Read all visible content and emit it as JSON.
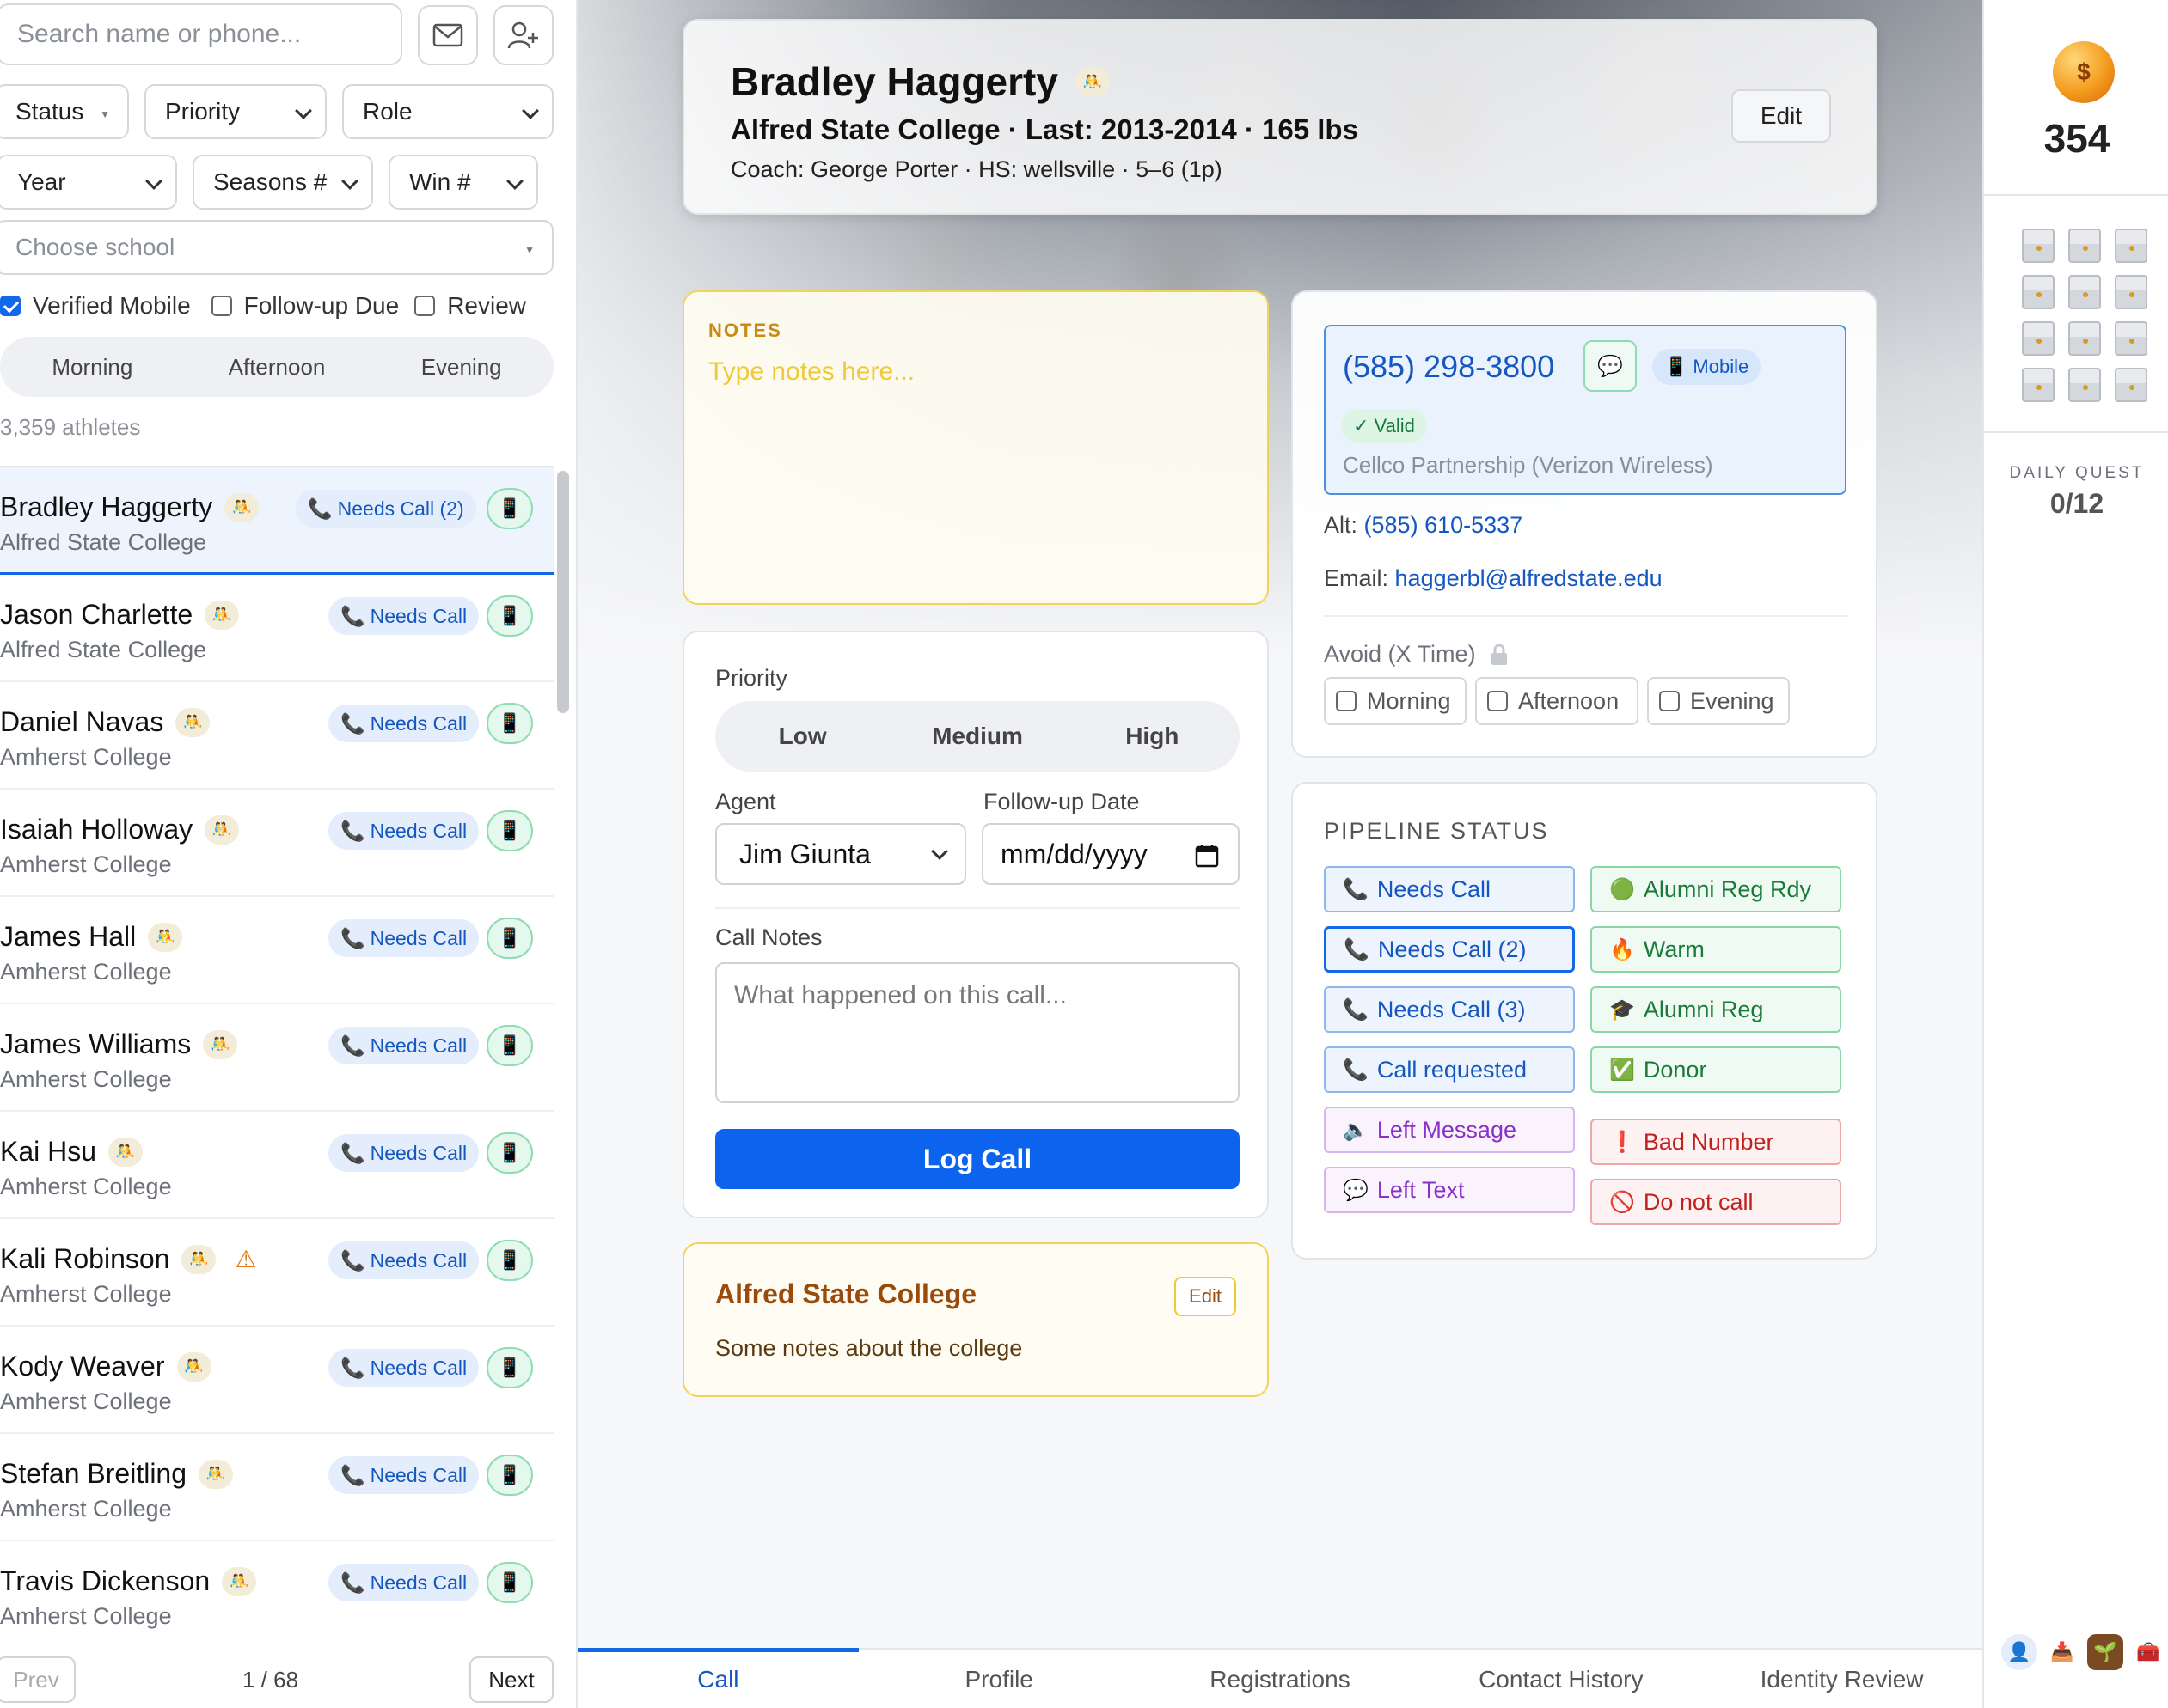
{
  "sidebar": {
    "search_placeholder": "Search name or phone...",
    "filters": {
      "status": "Status",
      "priority": "Priority",
      "role": "Role",
      "year": "Year",
      "seasons": "Seasons #",
      "win": "Win #",
      "school_placeholder": "Choose school"
    },
    "checkboxes": [
      {
        "label": "Verified Mobile",
        "checked": true
      },
      {
        "label": "Follow-up Due",
        "checked": false
      },
      {
        "label": "Review",
        "checked": false
      }
    ],
    "time_segments": [
      "Morning",
      "Afternoon",
      "Evening"
    ],
    "count": "3,359 athletes",
    "athletes": [
      {
        "name": "Bradley Haggerty",
        "school": "Alfred State College",
        "status": "Needs Call (2)",
        "active": true,
        "warning": false
      },
      {
        "name": "Jason Charlette",
        "school": "Alfred State College",
        "status": "Needs Call",
        "active": false,
        "warning": false
      },
      {
        "name": "Daniel Navas",
        "school": "Amherst College",
        "status": "Needs Call",
        "active": false,
        "warning": false
      },
      {
        "name": "Isaiah Holloway",
        "school": "Amherst College",
        "status": "Needs Call",
        "active": false,
        "warning": false
      },
      {
        "name": "James Hall",
        "school": "Amherst College",
        "status": "Needs Call",
        "active": false,
        "warning": false
      },
      {
        "name": "James Williams",
        "school": "Amherst College",
        "status": "Needs Call",
        "active": false,
        "warning": false
      },
      {
        "name": "Kai Hsu",
        "school": "Amherst College",
        "status": "Needs Call",
        "active": false,
        "warning": false
      },
      {
        "name": "Kali Robinson",
        "school": "Amherst College",
        "status": "Needs Call",
        "active": false,
        "warning": true
      },
      {
        "name": "Kody Weaver",
        "school": "Amherst College",
        "status": "Needs Call",
        "active": false,
        "warning": false
      },
      {
        "name": "Stefan Breitling",
        "school": "Amherst College",
        "status": "Needs Call",
        "active": false,
        "warning": false
      },
      {
        "name": "Travis Dickenson",
        "school": "Amherst College",
        "status": "Needs Call",
        "active": false,
        "warning": false
      }
    ],
    "pagination": {
      "prev": "Prev",
      "info": "1 / 68",
      "next": "Next"
    }
  },
  "header": {
    "name": "Bradley Haggerty",
    "line2": "Alfred State College · Last: 2013-2014 · 165 lbs",
    "line3": "Coach: George Porter · HS: wellsville · 5–6 (1p)",
    "edit": "Edit"
  },
  "notes": {
    "label": "NOTES",
    "placeholder": "Type notes here..."
  },
  "call": {
    "priority_label": "Priority",
    "priority_options": [
      "Low",
      "Medium",
      "High"
    ],
    "agent_label": "Agent",
    "agent_value": "Jim Giunta",
    "followup_label": "Follow-up Date",
    "followup_value": "mm/dd/yyyy",
    "call_notes_label": "Call Notes",
    "call_notes_placeholder": "What happened on this call...",
    "log_call": "Log Call"
  },
  "college": {
    "name": "Alfred State College",
    "edit": "Edit",
    "notes": "Some notes about the college"
  },
  "contact": {
    "phone": "(585) 298-3800",
    "mobile_badge": "Mobile",
    "valid_badge": "✓ Valid",
    "carrier": "Cellco Partnership (Verizon Wireless)",
    "alt_label": "Alt:",
    "alt_phone": "(585) 610-5337",
    "email_label": "Email:",
    "email": "haggerbl@alfredstate.edu",
    "avoid_label": "Avoid (X Time)",
    "avoid_options": [
      "Morning",
      "Afternoon",
      "Evening"
    ]
  },
  "pipeline": {
    "title": "PIPELINE STATUS",
    "left": [
      {
        "label": "Needs Call",
        "icon": "phone-icon",
        "style": "blue",
        "selected": false
      },
      {
        "label": "Needs Call (2)",
        "icon": "phone-icon",
        "style": "blue",
        "selected": true
      },
      {
        "label": "Needs Call (3)",
        "icon": "phone-icon",
        "style": "blue",
        "selected": false
      },
      {
        "label": "Call requested",
        "icon": "phone-icon",
        "style": "blue",
        "selected": false
      },
      {
        "label": "Left Message",
        "icon": "speaker-icon",
        "style": "purple",
        "selected": false
      },
      {
        "label": "Left Text",
        "icon": "speech-bubble-icon",
        "style": "purple",
        "selected": false
      }
    ],
    "right": [
      {
        "label": "Alumni Reg Rdy",
        "icon": "green-circle-icon",
        "style": "green"
      },
      {
        "label": "Warm",
        "icon": "fire-icon",
        "style": "green"
      },
      {
        "label": "Alumni Reg",
        "icon": "graduation-cap-icon",
        "style": "green"
      },
      {
        "label": "Donor",
        "icon": "check-box-icon",
        "style": "green"
      },
      {
        "label": "Bad Number",
        "icon": "exclamation-icon",
        "style": "red"
      },
      {
        "label": "Do not call",
        "icon": "prohibited-icon",
        "style": "red"
      }
    ]
  },
  "tabs": [
    "Call",
    "Profile",
    "Registrations",
    "Contact History",
    "Identity Review"
  ],
  "active_tab": "Call",
  "rail": {
    "coins": "354",
    "daily_quest_label": "DAILY QUEST",
    "daily_quest_value": "0/12"
  },
  "colors": {
    "accent": "#1368e8",
    "primary_button": "#0b63ee",
    "notes_border": "#f2d35a"
  }
}
